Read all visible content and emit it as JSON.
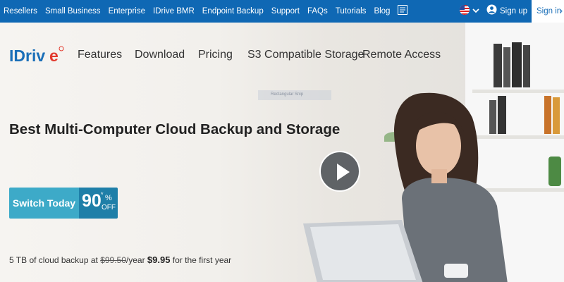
{
  "topbar": {
    "links": [
      "Resellers",
      "Small Business",
      "Enterprise",
      "IDrive BMR",
      "Endpoint Backup",
      "Support",
      "FAQs",
      "Tutorials",
      "Blog"
    ],
    "signup_label": "Sign up",
    "signin_label": "Sign in",
    "signin_arrow": "›"
  },
  "logo": {
    "text": "IDriv",
    "letter_e": "e"
  },
  "mainnav": {
    "items": [
      "Features",
      "Download",
      "Pricing",
      "S3 Compatible Storage",
      "Remote Access"
    ]
  },
  "hero": {
    "tooltip_text": "Rectangular Snip",
    "headline": "Best Multi-Computer Cloud Backup and Storage",
    "cta_label": "Switch Today",
    "discount_number": "90",
    "discount_star": "*",
    "discount_percent": "%",
    "discount_off": "OFF",
    "offer_prefix": "5 TB of cloud backup at ",
    "offer_old_price": "$99.50",
    "offer_suffix_1": "/year ",
    "offer_new_price": "$9.95",
    "offer_suffix_2": " for the first year"
  },
  "colors": {
    "topbar": "#0f68b4",
    "cta": "#3daac8",
    "cta_discount": "#1e7fa8",
    "logo_blue": "#1a6fb8",
    "logo_red": "#e23a2e"
  },
  "icons": {
    "doc": "document-icon",
    "flag": "us-flag-icon",
    "chevron": "chevron-down-icon",
    "user": "user-icon",
    "play": "play-icon"
  }
}
